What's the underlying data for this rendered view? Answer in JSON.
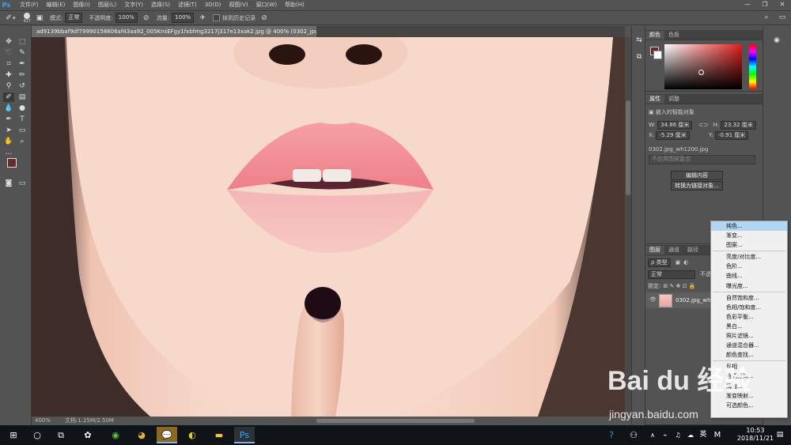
{
  "app": {
    "logo": "Ps"
  },
  "menubar": {
    "items": [
      "文件(F)",
      "编辑(E)",
      "图像(I)",
      "图层(L)",
      "文字(Y)",
      "选择(S)",
      "滤镜(T)",
      "3D(D)",
      "视图(V)",
      "窗口(W)",
      "帮助(H)"
    ],
    "window_controls": [
      "—",
      "❐",
      "✕"
    ]
  },
  "options": {
    "brush_size": "427",
    "mode_label": "模式:",
    "mode_value": "正常",
    "opacity_label": "不透明度:",
    "opacity_value": "100%",
    "flow_label": "流量:",
    "flow_value": "100%",
    "history_label": "抹到历史记录"
  },
  "document": {
    "tab_title": "ad9139bbaf9df79990158806af43aa92_005KnsEFgy1fxbfmg3217j317e13xak2.jpg @ 400% (0302_jpg_wh1200, RGB/8#) *",
    "close_icon": "×",
    "zoom": "400%",
    "doc_info": "文档:1.25M/2.50M"
  },
  "color_panel": {
    "tabs": [
      "颜色",
      "色板"
    ]
  },
  "properties_panel": {
    "tabs": [
      "属性",
      "调整"
    ],
    "object_type": "嵌入的智能对象",
    "w_label": "W:",
    "w_value": "34.86 厘米",
    "h_label": "H:",
    "h_value": "23.32 厘米",
    "x_label": "X:",
    "x_value": "-5.29 厘米",
    "y_label": "Y:",
    "y_value": "-0.91 厘米",
    "filename": "0302.jpg_wh1200.jpg",
    "comp_placeholder": "不应用图层复合",
    "edit_button": "编辑内容",
    "convert_button": "转换为链接对象..."
  },
  "layers_panel": {
    "tabs": [
      "图层",
      "通道",
      "路径"
    ],
    "filter_label": "ρ 类型",
    "blend_mode": "正常",
    "opacity_label": "不透",
    "lock_label": "锁定:",
    "layer_name": "0302.jpg_wh1200"
  },
  "adjustment_menu": {
    "groups": [
      [
        "纯色...",
        "渐变...",
        "图案..."
      ],
      [
        "亮度/对比度...",
        "色阶...",
        "曲线...",
        "曝光度..."
      ],
      [
        "自然饱和度...",
        "色相/饱和度...",
        "色彩平衡...",
        "黑白...",
        "照片滤镜...",
        "通道混合器...",
        "颜色查找..."
      ],
      [
        "反相",
        "色调分离...",
        "阈值...",
        "渐变映射...",
        "可选颜色..."
      ]
    ],
    "highlighted": "纯色..."
  },
  "taskbar": {
    "time": "10:53",
    "date": "2018/11/21",
    "ime": "英",
    "im_label": "M"
  },
  "watermark": {
    "logo_text": "Bai du 经验",
    "url": "jingyan.baidu.com"
  },
  "colors": {
    "foreground": "#6b2a2a",
    "background": "#ffffff",
    "menu_highlight": "#b3d7f3"
  }
}
